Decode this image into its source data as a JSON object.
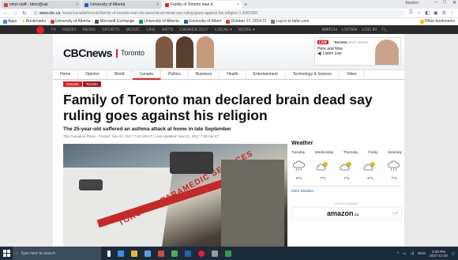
{
  "browser": {
    "tabs": [
      {
        "title": "mhei staff - bbov@ual",
        "color": "#d44638"
      },
      {
        "title": "University of Alberta",
        "color": "#2a5db0"
      },
      {
        "title": "Family of Toronto man d",
        "color": "#e21f26",
        "active": true
      }
    ],
    "user": "Biostrin",
    "window_controls": [
      "–",
      "□",
      "✕"
    ],
    "url": {
      "host": "www.cbc.ca",
      "path": "/news/canada/toronto/family-of-toronto-man-declared-brain-dead-say-ruling-goes-against-his-religion-1.4381580"
    },
    "bookmarks": [
      {
        "label": "Apps",
        "color": "#4285f4"
      },
      {
        "label": "Bookmarks",
        "color": "#f4b400"
      },
      {
        "label": "University of Alberta",
        "color": "#d44638"
      },
      {
        "label": "Microsoft Exchange",
        "color": "#555555"
      },
      {
        "label": "University of Alberta",
        "color": "#0f9d58"
      },
      {
        "label": "University of Albert",
        "color": "#2a5db0"
      },
      {
        "label": "October 17, 2014 CI",
        "color": "#d44638"
      },
      {
        "label": "Log in to tafsc.com",
        "color": "#777777"
      }
    ],
    "other_bookmarks": "Other bookmarks"
  },
  "cbc_top": {
    "nav": [
      "TV",
      "RADIO",
      "NEWS",
      "SPORTS",
      "MUSIC",
      "LIFE",
      "ARTS",
      "CANADA 2017",
      "LOCAL ▾",
      "MORE ▾"
    ],
    "right": [
      "WATCH",
      "LISTEN",
      "LOG IN"
    ]
  },
  "banner": {
    "logo_cbc": "CBC",
    "logo_news": "news",
    "city": "Toronto",
    "live_tag": "LIVE",
    "live_show": "Toronto",
    "live_show_more": "More Shows",
    "live_links": [
      "Here and Now",
      "◀) Listen Live"
    ]
  },
  "section_nav": [
    "Home",
    "Opinion",
    "World",
    "Canada",
    "Politics",
    "Business",
    "Health",
    "Entertainment",
    "Technology & Science",
    "Video"
  ],
  "active_section": "Canada",
  "breadcrumbs": [
    "Canada",
    "Toronto"
  ],
  "article": {
    "headline": "Family of Toronto man declared brain dead say ruling goes against his religion",
    "deck": "The 25-year-old suffered an asthma attack at home in late September",
    "byline": "The Canadian Press · Posted: Nov 01, 2017 7:42 AM ET  |  Last Updated: Nov 01, 2017 7:50 AM ET",
    "photo_text": "TORONTO PARAMEDIC SERVICES"
  },
  "weather": {
    "title": "Weather",
    "days": [
      "Tuesday",
      "Wednesday",
      "Thursday",
      "Friday",
      "Saturday"
    ],
    "temps": [
      "9°C",
      "7°C",
      "7°C",
      "6°C",
      "7°C"
    ],
    "icons": [
      "rain-cloud-icon",
      "partly-sunny-icon",
      "partly-sunny-icon",
      "partly-sunny-icon",
      "rain-cloud-icon"
    ],
    "more_link": "More Weather"
  },
  "ad": {
    "label": "ADVERTISEMENT",
    "brand": "amazon",
    "tld": ".ca",
    "choices": "▷X"
  },
  "taskbar": {
    "search_placeholder": "Type here to search",
    "app_colors": [
      "#ffffff",
      "#3a8ee6",
      "#e8b53a",
      "#5aa0e6",
      "#d44638",
      "#4caf50",
      "#2a5db0",
      "#e21f26",
      "#999999",
      "#2e9e4f"
    ],
    "tray_lang": "ENG",
    "time": "3:29 PM",
    "date": "2017-11-20"
  }
}
